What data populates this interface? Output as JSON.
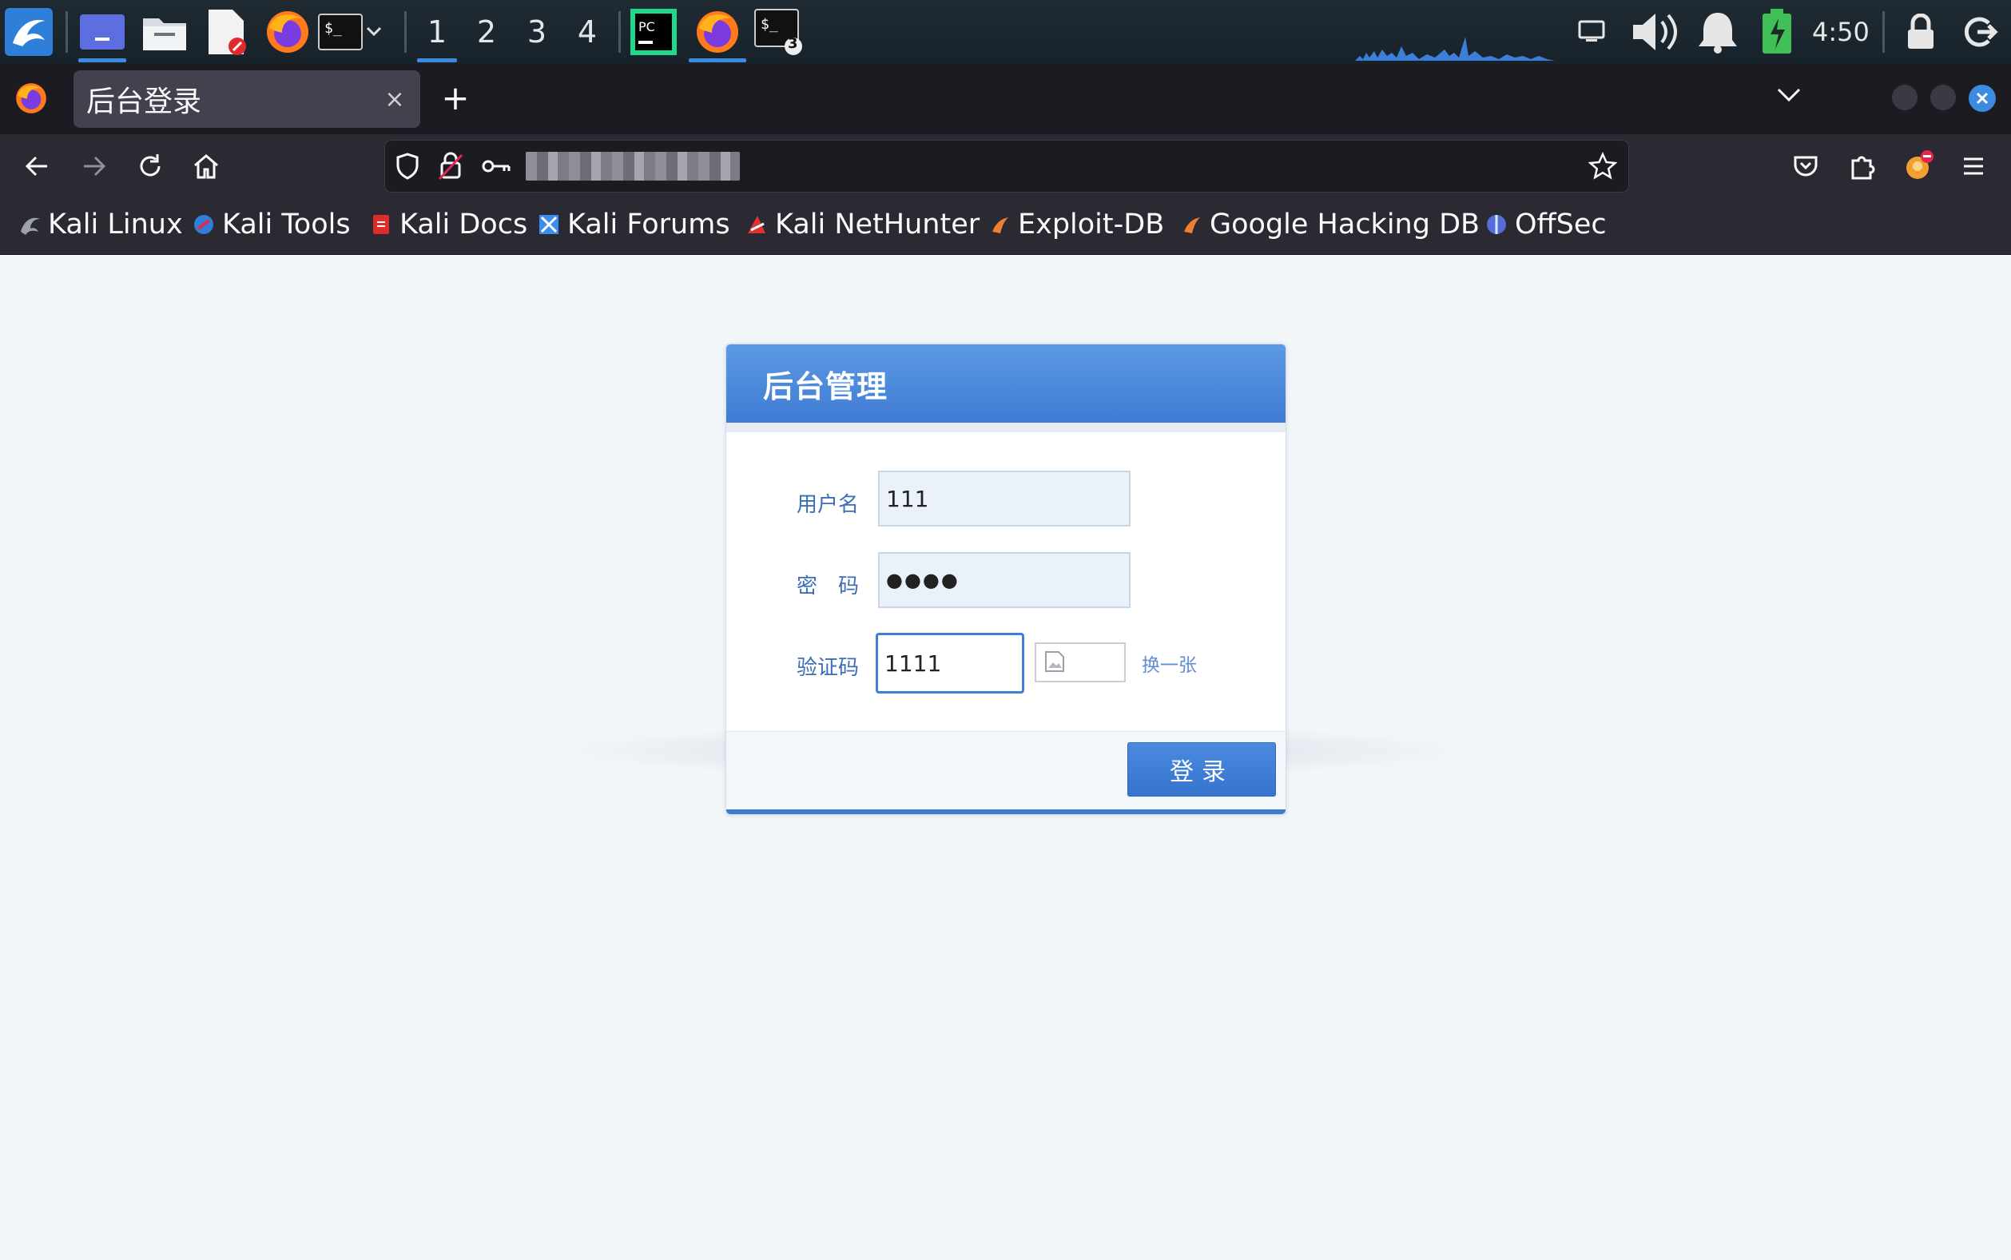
{
  "panel": {
    "workspaces": [
      "1",
      "2",
      "3",
      "4"
    ],
    "active_workspace": "1",
    "terminal_badge": "3",
    "clock": "4:50"
  },
  "tab": {
    "title": "后台登录",
    "close": "×",
    "new_tab": "+"
  },
  "bookmarks": [
    {
      "label": "Kali Linux",
      "icon": "kali-dragon-icon",
      "color": "#9aa3ad"
    },
    {
      "label": "Kali Tools",
      "icon": "kali-tools-icon",
      "color": "#2f7fd9"
    },
    {
      "label": "Kali Docs",
      "icon": "kali-docs-icon",
      "color": "#e02b2b"
    },
    {
      "label": "Kali Forums",
      "icon": "kali-forums-icon",
      "color": "#3b8ef0"
    },
    {
      "label": "Kali NetHunter",
      "icon": "nethunter-icon",
      "color": "#e03030"
    },
    {
      "label": "Exploit-DB",
      "icon": "exploit-db-icon",
      "color": "#f08030"
    },
    {
      "label": "Google Hacking DB",
      "icon": "ghdb-icon",
      "color": "#f08030"
    },
    {
      "label": "OffSec",
      "icon": "offsec-icon",
      "color": "#5a6bd8"
    }
  ],
  "login": {
    "title": "后台管理",
    "username_label": "用户名",
    "username_value": "111",
    "password_label": "密　码",
    "password_value": "●●●●",
    "captcha_label": "验证码",
    "captcha_value": "1111",
    "refresh_label": "换一张",
    "submit_label": "登录"
  },
  "colors": {
    "accent": "#3f7bd3",
    "label_blue": "#3b6eb6",
    "firefox_active": "#3d8be0"
  }
}
